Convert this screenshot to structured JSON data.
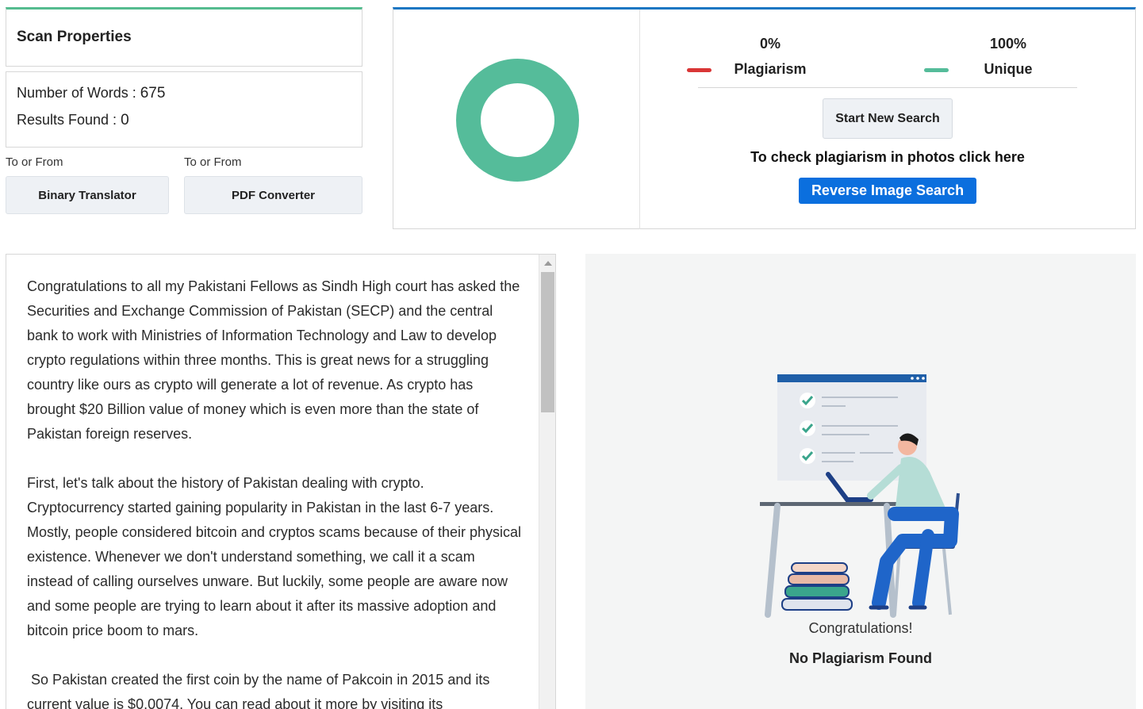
{
  "scan": {
    "title": "Scan Properties",
    "words_label": "Number of Words : ",
    "words_value": "675",
    "results_label": "Results Found : ",
    "results_value": "0"
  },
  "tools": [
    {
      "label": "To or From",
      "button": "Binary Translator"
    },
    {
      "label": "To or From",
      "button": "PDF Converter"
    }
  ],
  "results": {
    "plagiarism_pct": "0%",
    "plagiarism_label": "Plagiarism",
    "unique_pct": "100%",
    "unique_label": "Unique",
    "plagiarism_value": 0,
    "unique_value": 100,
    "colors": {
      "plagiarism": "#d93636",
      "unique": "#55bc9a"
    },
    "new_search": "Start New Search",
    "photos_text": "To check plagiarism in photos click here",
    "reverse_button": "Reverse Image Search"
  },
  "text": {
    "paragraphs": [
      "Congratulations to all my Pakistani Fellows as Sindh High court has asked the Securities and Exchange Commission of Pakistan (SECP) and the central bank to work with Ministries of Information Technology and Law to develop crypto regulations within three months. This is great news for a struggling country like ours as crypto will generate a lot of revenue. As crypto has brought $20 Billion value of money which is even more than the state of Pakistan foreign reserves.",
      "First, let's talk about the history of Pakistan dealing with crypto. Cryptocurrency started gaining popularity in Pakistan in the last 6-7 years. Mostly, people considered bitcoin and cryptos scams because of their physical existence. Whenever we don't understand something, we call it a scam instead of calling ourselves unware. But luckily, some people are aware now and some people are trying to learn about it after its massive adoption and bitcoin price boom to mars.",
      " So Pakistan created the first coin by the name of Pakcoin in 2015 and its current value is $0.0074. You can read about it more by visiting its"
    ]
  },
  "result_message": {
    "congrats": "Congratulations!",
    "no_plagiarism": "No Plagiarism Found"
  }
}
